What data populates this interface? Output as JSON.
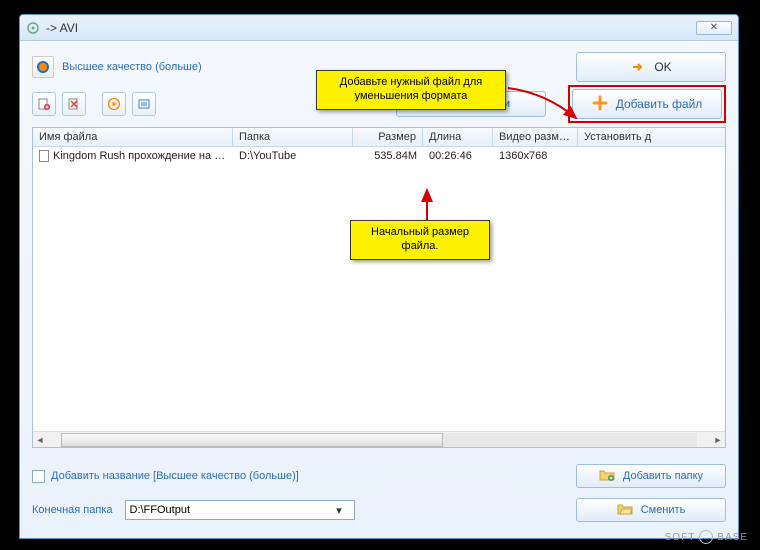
{
  "window": {
    "title": " -> AVI"
  },
  "header": {
    "quality_label": "Высшее качество (больше)",
    "ok_label": "OK",
    "settings_label": "Настройки",
    "add_file_label": "Добавить файл"
  },
  "table": {
    "columns": {
      "filename": "Имя файла",
      "folder": "Папка",
      "size": "Размер",
      "duration": "Длина",
      "video_size": "Видео размер",
      "set": "Установить д"
    },
    "row": {
      "filename": "Kingdom Rush прохождение на ПК ...",
      "folder": "D:\\YouTube",
      "size": "535.84M",
      "duration": "00:26:46",
      "video_size": "1360x768"
    }
  },
  "bottom": {
    "add_title_label": "Добавить название [Высшее качество (больше)]",
    "add_folder_label": "Добавить папку",
    "output_label": "Конечная папка",
    "output_path": "D:\\FFOutput",
    "change_label": "Сменить"
  },
  "callouts": {
    "top": "Добавьте нужный файл для уменьшения формата",
    "mid": "Начальный размер файла."
  },
  "watermark": {
    "text1": "SOFT",
    "text2": "BASE"
  }
}
